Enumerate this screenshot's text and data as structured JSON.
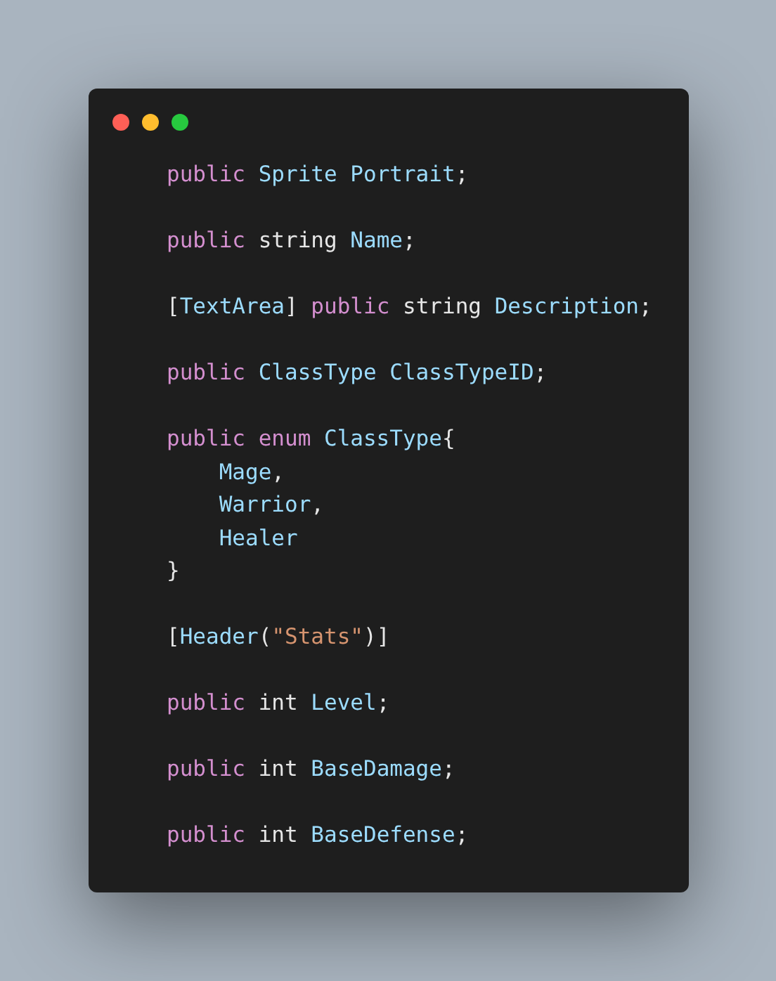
{
  "window": {
    "controls": [
      {
        "kind": "close"
      },
      {
        "kind": "minimize"
      },
      {
        "kind": "maximize"
      }
    ]
  },
  "lines": [
    {
      "kind": "code",
      "tokens": [
        {
          "text": "public ",
          "kind": "keyword"
        },
        {
          "text": "Sprite Portrait",
          "kind": "type"
        },
        {
          "text": ";",
          "kind": "plain"
        }
      ]
    },
    {
      "kind": "blank"
    },
    {
      "kind": "code",
      "tokens": [
        {
          "text": "public ",
          "kind": "keyword"
        },
        {
          "text": "string ",
          "kind": "plain"
        },
        {
          "text": "Name",
          "kind": "type"
        },
        {
          "text": ";",
          "kind": "plain"
        }
      ]
    },
    {
      "kind": "blank"
    },
    {
      "kind": "code",
      "tokens": [
        {
          "text": "[",
          "kind": "plain"
        },
        {
          "text": "TextArea",
          "kind": "type"
        },
        {
          "text": "] ",
          "kind": "plain"
        },
        {
          "text": "public ",
          "kind": "keyword"
        },
        {
          "text": "string ",
          "kind": "plain"
        },
        {
          "text": "Description",
          "kind": "type"
        },
        {
          "text": ";",
          "kind": "plain"
        }
      ]
    },
    {
      "kind": "blank"
    },
    {
      "kind": "code",
      "tokens": [
        {
          "text": "public ",
          "kind": "keyword"
        },
        {
          "text": "ClassType ClassTypeID",
          "kind": "type"
        },
        {
          "text": ";",
          "kind": "plain"
        }
      ]
    },
    {
      "kind": "blank"
    },
    {
      "kind": "code",
      "tokens": [
        {
          "text": "public enum ",
          "kind": "keyword"
        },
        {
          "text": "ClassType",
          "kind": "type"
        },
        {
          "text": "{",
          "kind": "plain"
        }
      ]
    },
    {
      "kind": "code",
      "tokens": [
        {
          "text": "    Mage",
          "kind": "type"
        },
        {
          "text": ",",
          "kind": "plain"
        }
      ]
    },
    {
      "kind": "code",
      "tokens": [
        {
          "text": "    Warrior",
          "kind": "type"
        },
        {
          "text": ",",
          "kind": "plain"
        }
      ]
    },
    {
      "kind": "code",
      "tokens": [
        {
          "text": "    Healer",
          "kind": "type"
        }
      ]
    },
    {
      "kind": "code",
      "tokens": [
        {
          "text": "}",
          "kind": "plain"
        }
      ]
    },
    {
      "kind": "blank"
    },
    {
      "kind": "code",
      "tokens": [
        {
          "text": "[",
          "kind": "plain"
        },
        {
          "text": "Header",
          "kind": "type"
        },
        {
          "text": "(",
          "kind": "plain"
        },
        {
          "text": "\"Stats\"",
          "kind": "string"
        },
        {
          "text": ")]",
          "kind": "plain"
        }
      ]
    },
    {
      "kind": "blank"
    },
    {
      "kind": "code",
      "tokens": [
        {
          "text": "public ",
          "kind": "keyword"
        },
        {
          "text": "int ",
          "kind": "plain"
        },
        {
          "text": "Level",
          "kind": "type"
        },
        {
          "text": ";",
          "kind": "plain"
        }
      ]
    },
    {
      "kind": "blank"
    },
    {
      "kind": "code",
      "tokens": [
        {
          "text": "public ",
          "kind": "keyword"
        },
        {
          "text": "int ",
          "kind": "plain"
        },
        {
          "text": "BaseDamage",
          "kind": "type"
        },
        {
          "text": ";",
          "kind": "plain"
        }
      ]
    },
    {
      "kind": "blank"
    },
    {
      "kind": "code",
      "tokens": [
        {
          "text": "public ",
          "kind": "keyword"
        },
        {
          "text": "int ",
          "kind": "plain"
        },
        {
          "text": "BaseDefense",
          "kind": "type"
        },
        {
          "text": ";",
          "kind": "plain"
        }
      ]
    }
  ]
}
